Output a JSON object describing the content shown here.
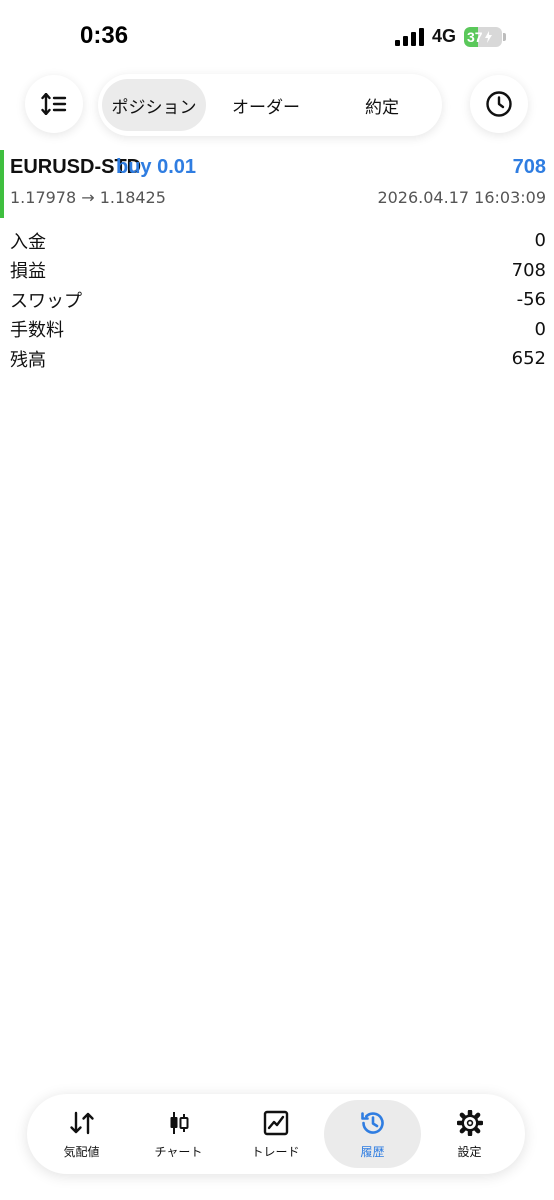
{
  "status_bar": {
    "time": "0:36",
    "network": "4G",
    "battery": "37",
    "battery_level": 0.37
  },
  "top_bar": {
    "tabs": [
      {
        "label": "ポジション",
        "active": true
      },
      {
        "label": "オーダー",
        "active": false
      },
      {
        "label": "約定",
        "active": false
      }
    ],
    "sort_icon": "sort-icon",
    "history_icon": "clock-icon"
  },
  "trade": {
    "symbol": "EURUSD-STD",
    "side": "buy 0.01",
    "profit": "708",
    "prices": "1.17978 → 1.18425",
    "datetime": "2026.04.17 16:03:09"
  },
  "details": [
    {
      "label": "入金",
      "value": "0"
    },
    {
      "label": "損益",
      "value": "708"
    },
    {
      "label": "スワップ",
      "value": "-56"
    },
    {
      "label": "手数料",
      "value": "0"
    },
    {
      "label": "残高",
      "value": "652"
    }
  ],
  "bottom_nav": [
    {
      "label": "気配値",
      "icon": "quotes-icon",
      "active": false
    },
    {
      "label": "チャート",
      "icon": "chart-icon",
      "active": false
    },
    {
      "label": "トレード",
      "icon": "trade-icon",
      "active": false
    },
    {
      "label": "履歴",
      "icon": "history-icon",
      "active": true
    },
    {
      "label": "設定",
      "icon": "settings-icon",
      "active": false
    }
  ],
  "colors": {
    "accent": "#2f7de1",
    "buy_bar": "#3fbf3f",
    "battery": "#5ac85a"
  }
}
